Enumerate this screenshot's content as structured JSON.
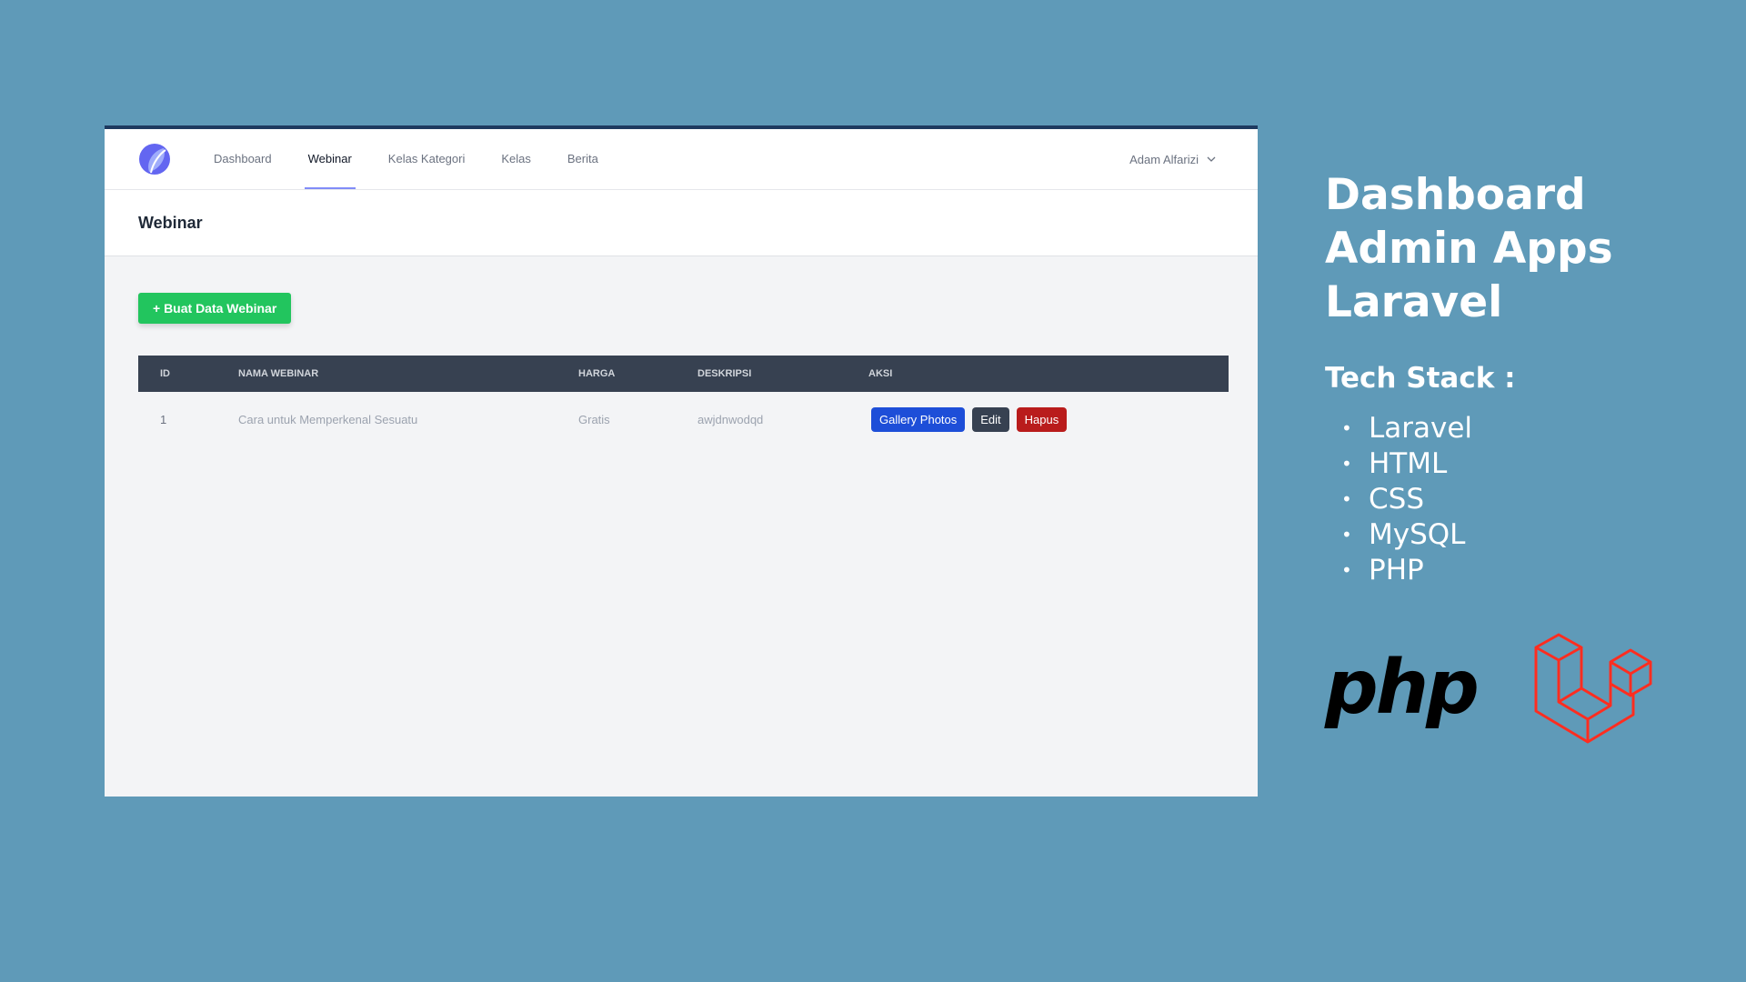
{
  "nav": {
    "items": [
      {
        "label": "Dashboard"
      },
      {
        "label": "Webinar"
      },
      {
        "label": "Kelas Kategori"
      },
      {
        "label": "Kelas"
      },
      {
        "label": "Berita"
      }
    ],
    "active": "Webinar",
    "user_name": "Adam Alfarizi",
    "logo_icon": "logo-icon",
    "chevron_icon": "chevron-down-icon"
  },
  "page": {
    "title": "Webinar",
    "create_button": "+ Buat Data Webinar"
  },
  "table": {
    "headers": [
      "ID",
      "NAMA WEBINAR",
      "HARGA",
      "DESKRIPSI",
      "AKSI"
    ],
    "rows": [
      {
        "id": "1",
        "nama": "Cara untuk Memperkenal Sesuatu",
        "harga": "Gratis",
        "deskripsi": "awjdnwodqd",
        "actions": {
          "gallery": "Gallery Photos",
          "edit": "Edit",
          "hapus": "Hapus"
        }
      }
    ]
  },
  "promo": {
    "title_lines": [
      "Dashboard",
      "Admin Apps",
      "Laravel"
    ],
    "stack_title": "Tech Stack :",
    "stack": [
      "Laravel",
      "HTML",
      "CSS",
      "MySQL",
      "PHP"
    ],
    "php_logo_text": "php"
  },
  "colors": {
    "background": "#5f9ab8",
    "create_button": "#22c55e",
    "gallery_button": "#1d4ed8",
    "edit_button": "#374151",
    "hapus_button": "#b91c1c",
    "table_header": "#374151",
    "laravel_red": "#ff2d20"
  }
}
